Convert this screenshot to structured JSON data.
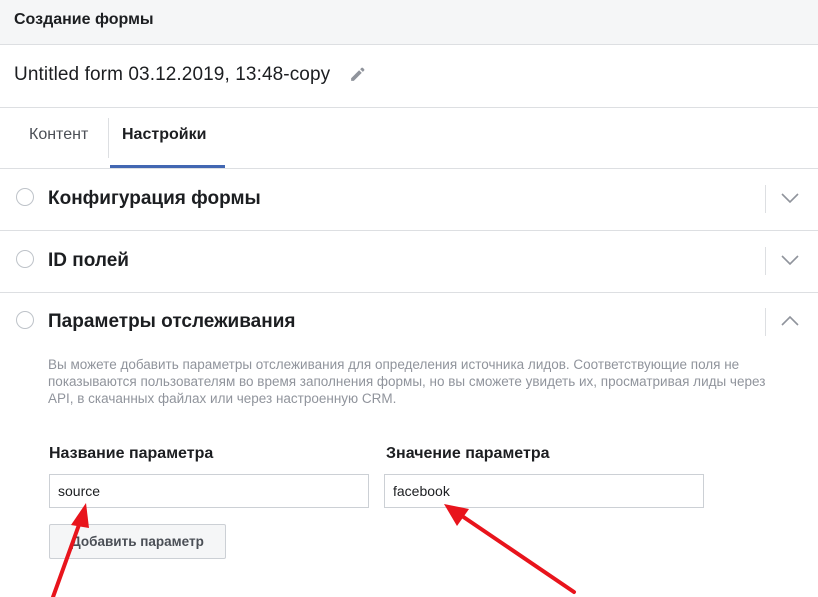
{
  "header": {
    "title": "Создание формы"
  },
  "form": {
    "name": "Untitled form 03.12.2019, 13:48-copy",
    "edit_icon": "pencil-icon"
  },
  "tabs": [
    {
      "label": "Контент",
      "active": false
    },
    {
      "label": "Настройки",
      "active": true
    }
  ],
  "sections": [
    {
      "title": "Конфигурация формы",
      "expanded": false
    },
    {
      "title": "ID полей",
      "expanded": false
    },
    {
      "title": "Параметры отслеживания",
      "expanded": true
    }
  ],
  "tracking": {
    "description": "Вы можете добавить параметры отслеживания для определения источника лидов. Соответствующие поля не показываются пользователям во время заполнения формы, но вы сможете увидеть их, просматривая лиды через API, в скачанных файлах или через настроенную CRM.",
    "name_label": "Название параметра",
    "value_label": "Значение параметра",
    "name_value": "source",
    "value_value": "facebook",
    "add_button": "Добавить параметр"
  },
  "colors": {
    "accent": "#4267b2",
    "annotation_arrow": "#e8141c",
    "muted_text": "#90949c"
  }
}
